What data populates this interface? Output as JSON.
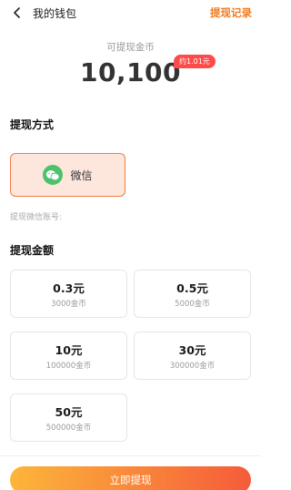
{
  "header": {
    "back_icon": "chevron-left-icon",
    "title": "我的钱包",
    "history_link": "提现记录"
  },
  "balance": {
    "caption": "可提现金币",
    "amount": "10,100",
    "approx": "约1.01元"
  },
  "method_section": {
    "title": "提现方式",
    "method_icon": "wechat-icon",
    "method_label": "微信",
    "account_hint": "提现微信账号:"
  },
  "amount_section": {
    "title": "提现金额",
    "options": [
      {
        "value": "0.3元",
        "coins": "3000金币"
      },
      {
        "value": "0.5元",
        "coins": "5000金币"
      },
      {
        "value": "10元",
        "coins": "100000金币"
      },
      {
        "value": "30元",
        "coins": "300000金币"
      },
      {
        "value": "50元",
        "coins": "500000金币"
      }
    ]
  },
  "footer": {
    "withdraw_label": "立即提现"
  },
  "colors": {
    "accent": "#f07a1e",
    "badge": "#ff4a4a",
    "selected_bg": "#fde6dc",
    "selected_border": "#ef7d47",
    "wechat_green": "#4cc26b"
  }
}
